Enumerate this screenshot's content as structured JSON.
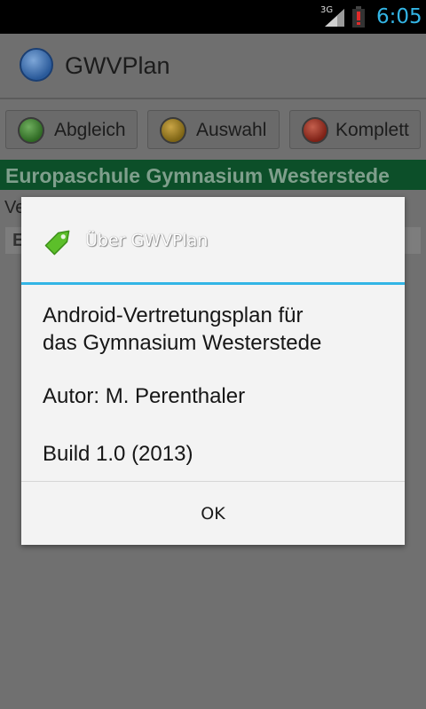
{
  "status_bar": {
    "network": "3G",
    "time": "6:05",
    "time_color": "#33b5e5"
  },
  "app": {
    "title": "GWVPlan",
    "buttons": [
      {
        "label": "Abgleich",
        "lamp": "green"
      },
      {
        "label": "Auswahl",
        "lamp": "yellow"
      },
      {
        "label": "Komplett",
        "lamp": "red"
      }
    ],
    "school_title": "Europaschule Gymnasium Westerstede",
    "sub_label": "Ve",
    "sub_box_text": "E"
  },
  "dialog": {
    "icon": "tag-icon",
    "title": "Über GWVPlan",
    "message_line1": "Android-Vertretungsplan für",
    "message_line2": "das Gymnasium Westerstede",
    "author": "Autor: M. Perenthaler",
    "build": "Build 1.0 (2013)",
    "ok_label": "OK",
    "accent_color": "#33b5e5"
  }
}
